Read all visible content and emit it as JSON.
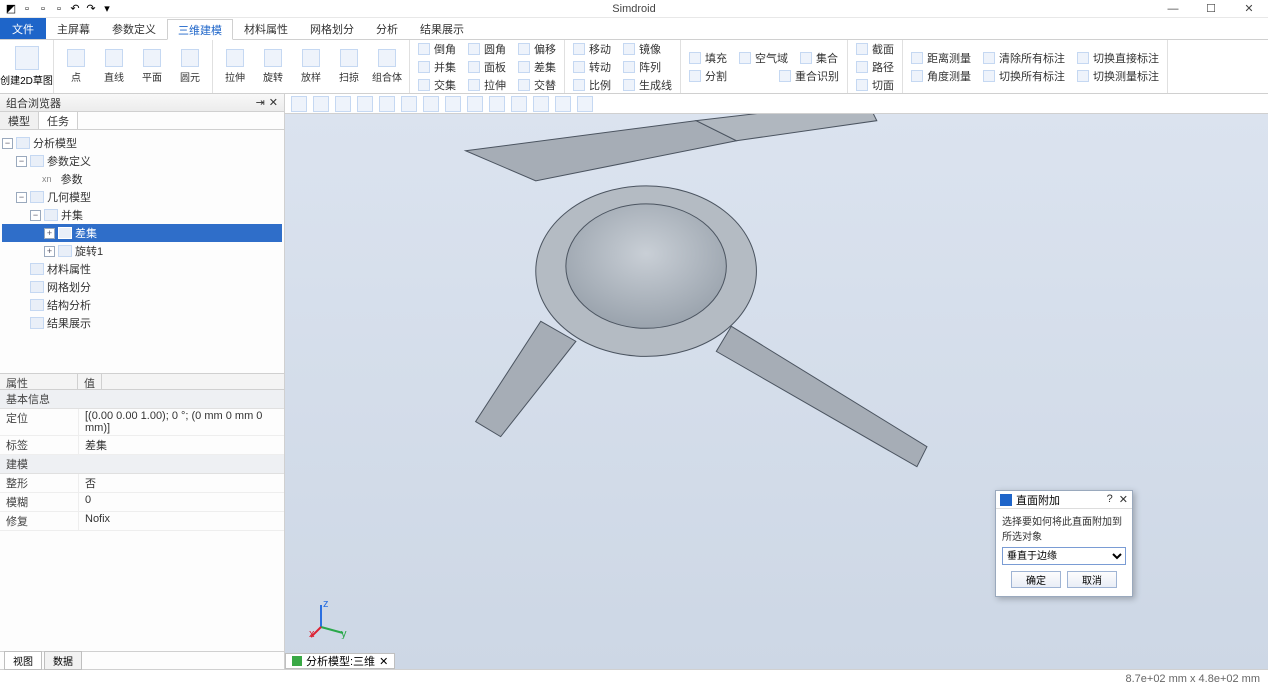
{
  "app": {
    "title": "Simdroid"
  },
  "menu": {
    "file": "文件",
    "tabs": [
      "主屏幕",
      "参数定义",
      "三维建模",
      "材料属性",
      "网格划分",
      "分析",
      "结果展示"
    ],
    "active_index": 2
  },
  "ribbon": {
    "big": {
      "label": "创建2D草图"
    },
    "group_draw": [
      "点",
      "直线",
      "平面",
      "圆元"
    ],
    "group_bool": [
      "拉伸",
      "旋转",
      "放样",
      "扫掠",
      "组合体"
    ],
    "group_edit1": [
      [
        "倒角",
        "圆角",
        "偏移"
      ],
      [
        "并集",
        "面板",
        "差集"
      ],
      [
        "交集",
        "拉伸",
        "交替"
      ]
    ],
    "group_edit2": [
      [
        "移动",
        "转动",
        "比例"
      ],
      [
        "镜像",
        "阵列",
        "生成线"
      ]
    ],
    "group_fill": [
      [
        "填充",
        "分割"
      ],
      [
        "空气域",
        "集合",
        "重合识别"
      ]
    ],
    "group_ref": [
      "截面",
      "路径",
      "切面"
    ],
    "group_meas": [
      [
        "距离测量",
        "清除所有标注",
        "切换直接标注"
      ],
      [
        "角度测量",
        "切换所有标注",
        "切换测量标注"
      ]
    ]
  },
  "left_panel": {
    "title": "组合浏览器",
    "tabs": [
      "模型",
      "任务"
    ],
    "active_tab": 0,
    "tree": {
      "root": "分析模型",
      "param_def": "参数定义",
      "param_leaf": "参数",
      "geom": "几何模型",
      "union": "并集",
      "diff": "差集",
      "rotate": "旋转1",
      "material": "材料属性",
      "mesh": "网格划分",
      "struct": "结构分析",
      "result": "结果展示",
      "selected": "diff"
    }
  },
  "props": {
    "headers": [
      "属性",
      "值"
    ],
    "section1": "基本信息",
    "rows1": [
      {
        "k": "定位",
        "v": "[(0.00 0.00 1.00); 0 °; (0 mm  0 mm  0 mm)]"
      },
      {
        "k": "标签",
        "v": "差集"
      }
    ],
    "section2": "建模",
    "rows2": [
      {
        "k": "整形",
        "v": "否"
      },
      {
        "k": "模糊",
        "v": "0"
      },
      {
        "k": "修复",
        "v": "Nofix"
      }
    ]
  },
  "bottom_tabs": {
    "items": [
      "视图",
      "数据"
    ],
    "active": 0
  },
  "viewport": {
    "tab_label": "分析模型:三维",
    "triad_axes": [
      "x",
      "y",
      "z"
    ]
  },
  "dialog": {
    "title": "直面附加",
    "message": "选择要如何将此直面附加到所选对象",
    "option": "垂直于边缘",
    "ok": "确定",
    "cancel": "取消"
  },
  "status": {
    "dims": "8.7e+02 mm x 4.8e+02 mm"
  }
}
